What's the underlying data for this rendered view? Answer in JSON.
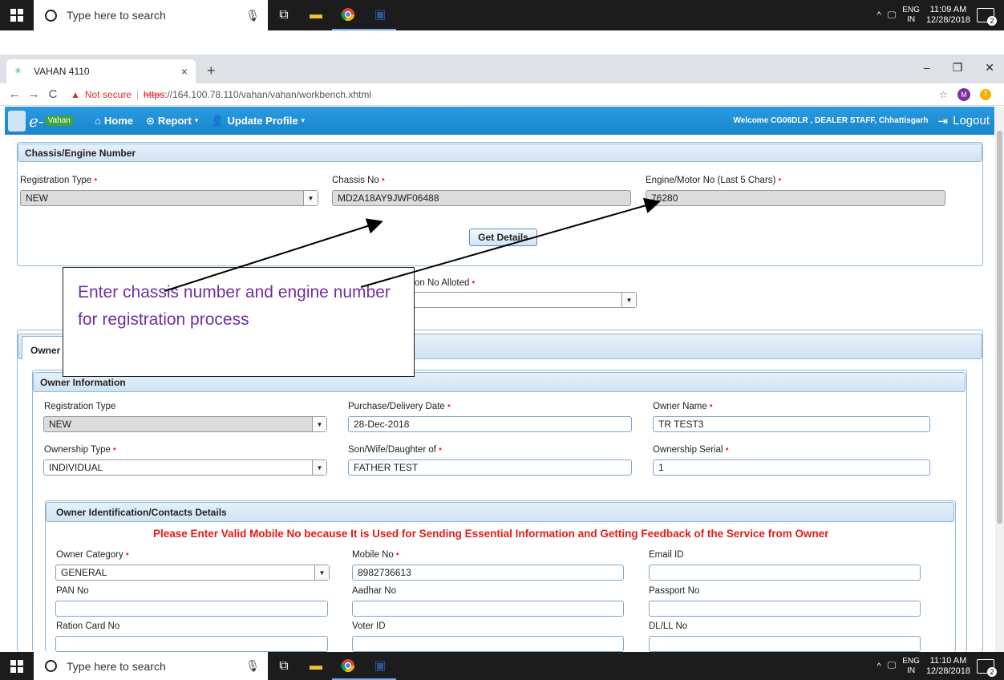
{
  "taskbar": {
    "search_placeholder": "Type here to search",
    "top": {
      "lang1": "ENG",
      "lang2": "IN",
      "time": "11:09 AM",
      "date": "12/28/2018",
      "notif_count": "2"
    },
    "bottom": {
      "lang1": "ENG",
      "lang2": "IN",
      "time": "11:10 AM",
      "date": "12/28/2018",
      "notif_count": "2"
    }
  },
  "browser": {
    "tab_title": "VAHAN 4110",
    "security_label": "Not secure",
    "url_scheme": "https",
    "url_rest": "://164.100.78.110/vahan/vahan/workbench.xhtml",
    "profile_initial": "M",
    "alert_symbol": "!"
  },
  "appnav": {
    "logo_text": "e-",
    "logo_badge": "Vahan",
    "home": "Home",
    "report": "Report",
    "update_profile": "Update Profile",
    "welcome": "Welcome CG06DLR , DEALER STAFF, Chhattisgarh",
    "logout": "Logout"
  },
  "chassis_panel": {
    "title": "Chassis/Engine Number",
    "registration_type_label": "Registration Type",
    "registration_type_value": "NEW",
    "chassis_label": "Chassis No",
    "chassis_value": "MD2A18AY9JWF06488",
    "engine_label": "Engine/Motor No (Last 5 Chars)",
    "engine_value": "76280",
    "get_details": "Get Details"
  },
  "alloted_label": "on No Alloted",
  "owner_tab": "Owner I",
  "owner_info": {
    "title": "Owner Information",
    "registration_type_label": "Registration Type",
    "registration_type_value": "NEW",
    "purchase_label": "Purchase/Delivery Date",
    "purchase_value": "28-Dec-2018",
    "owner_name_label": "Owner Name",
    "owner_name_value": "TR TEST3",
    "ownership_type_label": "Ownership Type",
    "ownership_type_value": "INDIVIDUAL",
    "swd_label": "Son/Wife/Daughter of",
    "swd_value": "FATHER TEST",
    "serial_label": "Ownership Serial",
    "serial_value": "1"
  },
  "contacts": {
    "title": "Owner Identification/Contacts Details",
    "notice": "Please Enter Valid Mobile No because It is Used for Sending Essential Information and Getting Feedback of the Service from Owner",
    "category_label": "Owner Category",
    "category_value": "GENERAL",
    "mobile_label": "Mobile No",
    "mobile_value": "8982736613",
    "email_label": "Email ID",
    "pan_label": "PAN No",
    "aadhar_label": "Aadhar No",
    "passport_label": "Passport No",
    "ration_label": "Ration Card No",
    "voter_label": "Voter ID",
    "dl_label": "DL/LL No"
  },
  "callout": "Enter chassis number and engine number for registration process"
}
